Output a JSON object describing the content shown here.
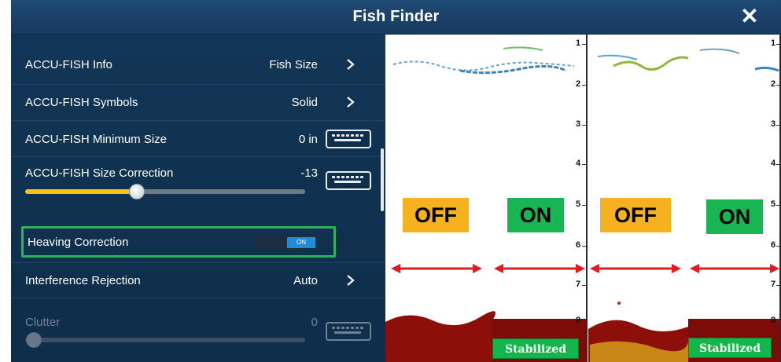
{
  "window": {
    "title": "Fish Finder",
    "close_glyph": "✕"
  },
  "menu": {
    "accu_fish_info": {
      "label": "ACCU-FISH Info",
      "value": "Fish Size"
    },
    "accu_fish_symbols": {
      "label": "ACCU-FISH Symbols",
      "value": "Solid"
    },
    "accu_fish_min_size": {
      "label": "ACCU-FISH Minimum Size",
      "value": "0 in"
    },
    "accu_fish_size_correction": {
      "label": "ACCU-FISH Size Correction",
      "value": "-13",
      "slider_fraction": 0.4
    },
    "heaving_correction": {
      "label": "Heaving Correction",
      "toggle_label": "ON",
      "state": "on"
    },
    "interference_rejection": {
      "label": "Interference Rejection",
      "value": "Auto"
    },
    "clutter": {
      "label": "Clutter",
      "value": "0",
      "slider_fraction": 0.03,
      "disabled": true
    }
  },
  "sonar": {
    "depth_scale": [
      "1",
      "2",
      "3",
      "4",
      "5",
      "6",
      "7",
      "8"
    ],
    "labels": {
      "off_left": "OFF",
      "on_left": "ON",
      "off_right": "OFF",
      "on_right": "ON",
      "stabilized_left": "Stabilized",
      "stabilized_right": "Stabilized"
    },
    "colors": {
      "off_tag": "#f5b21d",
      "on_tag": "#17b653",
      "stabilized_tag": "#12b64a",
      "arrow": "#e21c1c",
      "seabed": "#8c0f0a",
      "highlight_border": "#2fb35a",
      "slider_fill": "#f3c21b",
      "toggle_on": "#1e8ed8"
    },
    "icons": [
      "close-icon",
      "chevron-right-icon",
      "keyboard-icon",
      "double-arrow-icon"
    ]
  }
}
